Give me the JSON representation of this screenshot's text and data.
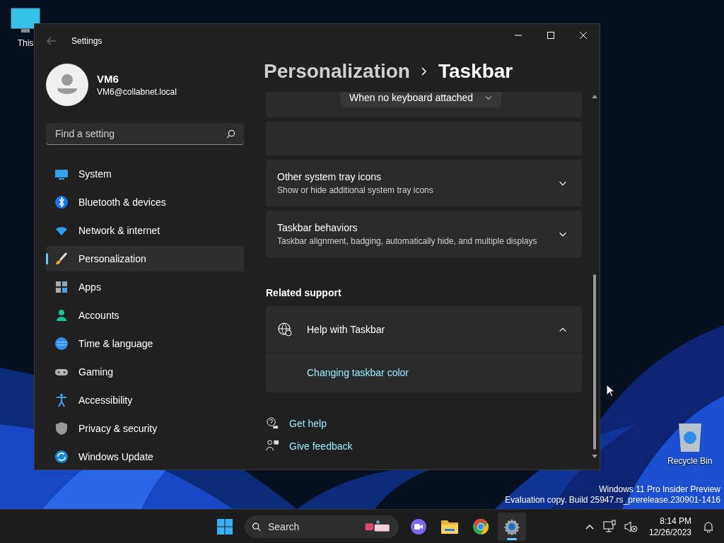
{
  "desktop": {
    "icons": [
      {
        "kind": "computer",
        "label": "This"
      },
      {
        "kind": "recycle",
        "label": "Recycle Bin"
      }
    ],
    "watermark": [
      "Windows 11 Pro Insider Preview",
      "Evaluation copy. Build 25947.rs_prerelease.230901-1416"
    ]
  },
  "window": {
    "title": "Settings",
    "user": {
      "name": "VM6",
      "email": "VM6@collabnet.local"
    },
    "search": {
      "placeholder": "Find a setting"
    },
    "nav": [
      {
        "label": "System",
        "selected": false
      },
      {
        "label": "Bluetooth & devices",
        "selected": false
      },
      {
        "label": "Network & internet",
        "selected": false
      },
      {
        "label": "Personalization",
        "selected": true
      },
      {
        "label": "Apps",
        "selected": false
      },
      {
        "label": "Accounts",
        "selected": false
      },
      {
        "label": "Time & language",
        "selected": false
      },
      {
        "label": "Gaming",
        "selected": false
      },
      {
        "label": "Accessibility",
        "selected": false
      },
      {
        "label": "Privacy & security",
        "selected": false
      },
      {
        "label": "Windows Update",
        "selected": false
      }
    ],
    "breadcrumb": [
      "Personalization",
      "Taskbar"
    ],
    "settings": [
      {
        "kind": "dropdown",
        "value": "When no keyboard attached"
      },
      {
        "kind": "blank"
      },
      {
        "kind": "expander",
        "title": "Other system tray icons",
        "description": "Show or hide additional system tray icons",
        "expanded": false
      },
      {
        "kind": "expander",
        "title": "Taskbar behaviors",
        "description": "Taskbar alignment, badging, automatically hide, and multiple displays",
        "expanded": false
      }
    ],
    "related": {
      "heading": "Related support",
      "items": [
        {
          "title": "Help with Taskbar",
          "expanded": true,
          "links": [
            "Changing taskbar color"
          ]
        }
      ]
    },
    "links": [
      {
        "kind": "help",
        "label": "Get help"
      },
      {
        "kind": "feedback",
        "label": "Give feedback"
      }
    ]
  },
  "taskbar": {
    "search": {
      "placeholder": "Search"
    },
    "apps": [
      {
        "kind": "chat",
        "selected": false
      },
      {
        "kind": "files",
        "selected": false
      },
      {
        "kind": "browser",
        "selected": false
      },
      {
        "kind": "settings",
        "selected": true
      }
    ],
    "clock": {
      "time": "8:14 PM",
      "date": "12/26/2023"
    }
  }
}
